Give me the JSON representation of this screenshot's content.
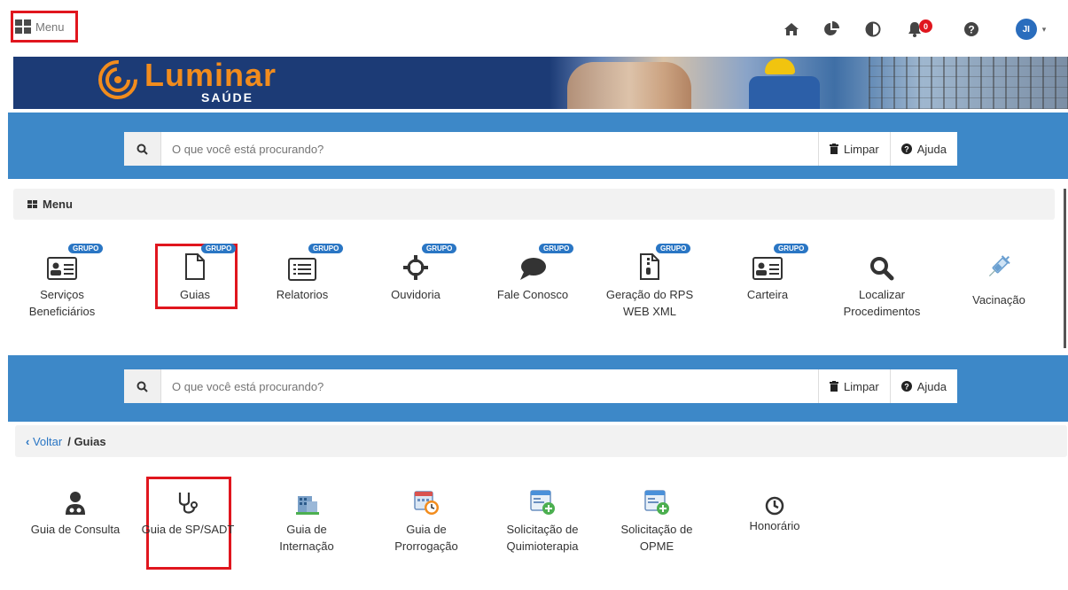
{
  "topbar": {
    "menu_label": "Menu",
    "notification_count": "0",
    "avatar_initials": "JI"
  },
  "banner": {
    "brand": "Luminar",
    "brand_sub": "SAÚDE"
  },
  "search": {
    "placeholder": "O que você está procurando?",
    "clear_label": "Limpar",
    "help_label": "Ajuda"
  },
  "menu_panel": {
    "title": "Menu",
    "group_badge": "GRUPO",
    "items": [
      {
        "label": "Serviços Beneficiários",
        "icon": "id-card-icon"
      },
      {
        "label": "Guias",
        "icon": "document-icon"
      },
      {
        "label": "Relatorios",
        "icon": "list-icon"
      },
      {
        "label": "Ouvidoria",
        "icon": "crosshair-icon"
      },
      {
        "label": "Fale Conosco",
        "icon": "speech-bubble-icon"
      },
      {
        "label": "Geração do RPS WEB XML",
        "icon": "xml-file-icon"
      },
      {
        "label": "Carteira",
        "icon": "id-card-icon"
      },
      {
        "label": "Localizar Procedimentos",
        "icon": "search-icon"
      },
      {
        "label": "Vacinação",
        "icon": "syringe-icon"
      }
    ]
  },
  "breadcrumb": {
    "back_label": "Voltar",
    "current": "/ Guias"
  },
  "guias": {
    "items": [
      {
        "label": "Guia de Consulta",
        "icon": "doctor-icon"
      },
      {
        "label": "Guia de SP/SADT",
        "icon": "stethoscope-icon"
      },
      {
        "label": "Guia de Internação",
        "icon": "hospital-icon"
      },
      {
        "label": "Guia de Prorrogação",
        "icon": "calendar-clock-icon"
      },
      {
        "label": "Solicitação de Quimioterapia",
        "icon": "add-form-icon"
      },
      {
        "label": "Solicitação de OPME",
        "icon": "add-form-icon"
      },
      {
        "label": "Honorário",
        "icon": "clock-icon"
      }
    ]
  },
  "colors": {
    "accent_blue": "#3d88c8",
    "highlight_red": "#e0161e",
    "brand_orange": "#f28c1d",
    "banner_navy": "#1c3b76"
  }
}
